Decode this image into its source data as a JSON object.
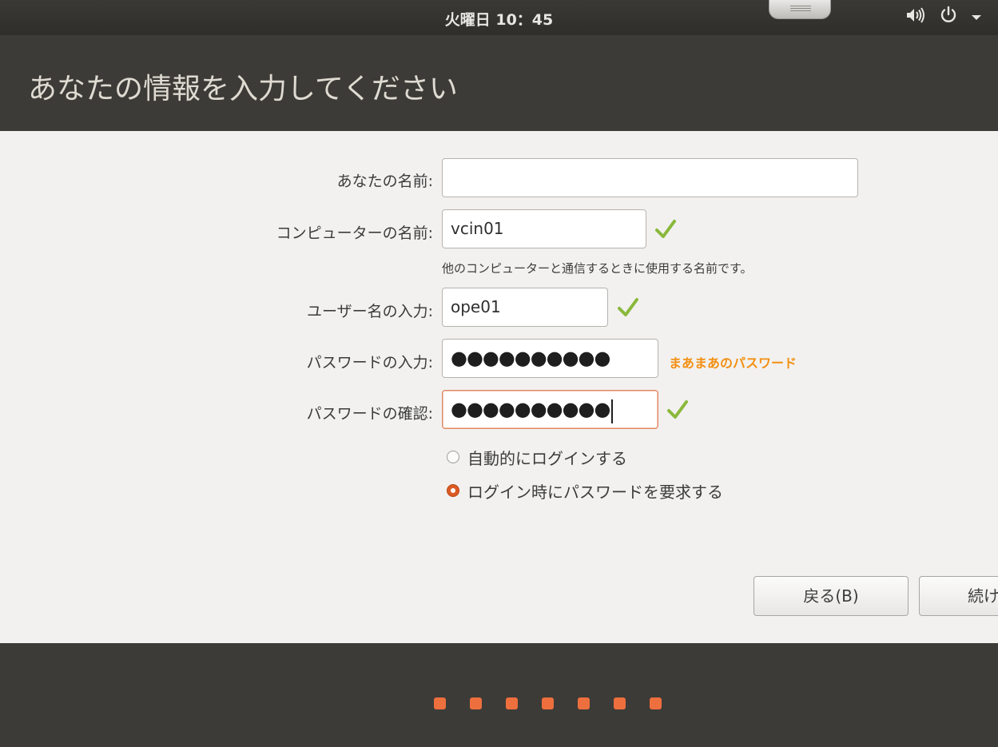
{
  "top_panel": {
    "clock": "火曜日 10：45",
    "icons": [
      "volume-icon",
      "power-icon",
      "menu-arrow-icon"
    ]
  },
  "header": {
    "title": "あなたの情報を入力してください"
  },
  "form": {
    "name_label": "あなたの名前:",
    "name_value": "",
    "computer_label": "コンピューターの名前:",
    "computer_value": "vcin01",
    "computer_hint": "他のコンピューターと通信するときに使用する名前です。",
    "username_label": "ユーザー名の入力:",
    "username_value": "ope01",
    "password_label": "パスワードの入力:",
    "password_value": "●●●●●●●●●●",
    "password_strength": "まあまあのパスワード",
    "confirm_label": "パスワードの確認:",
    "confirm_value": "●●●●●●●●●●",
    "auto_login_label": "自動的にログインする",
    "require_password_label": "ログイン時にパスワードを要求する",
    "selected_option": "require_password"
  },
  "buttons": {
    "back": "戻る(B)",
    "continue": "続け"
  },
  "progress": {
    "total_steps": 7
  },
  "colors": {
    "accent": "#ee6f3e",
    "check": "#8ab83c",
    "strength": "#f39012",
    "radio_selected": "#dd5a24"
  }
}
